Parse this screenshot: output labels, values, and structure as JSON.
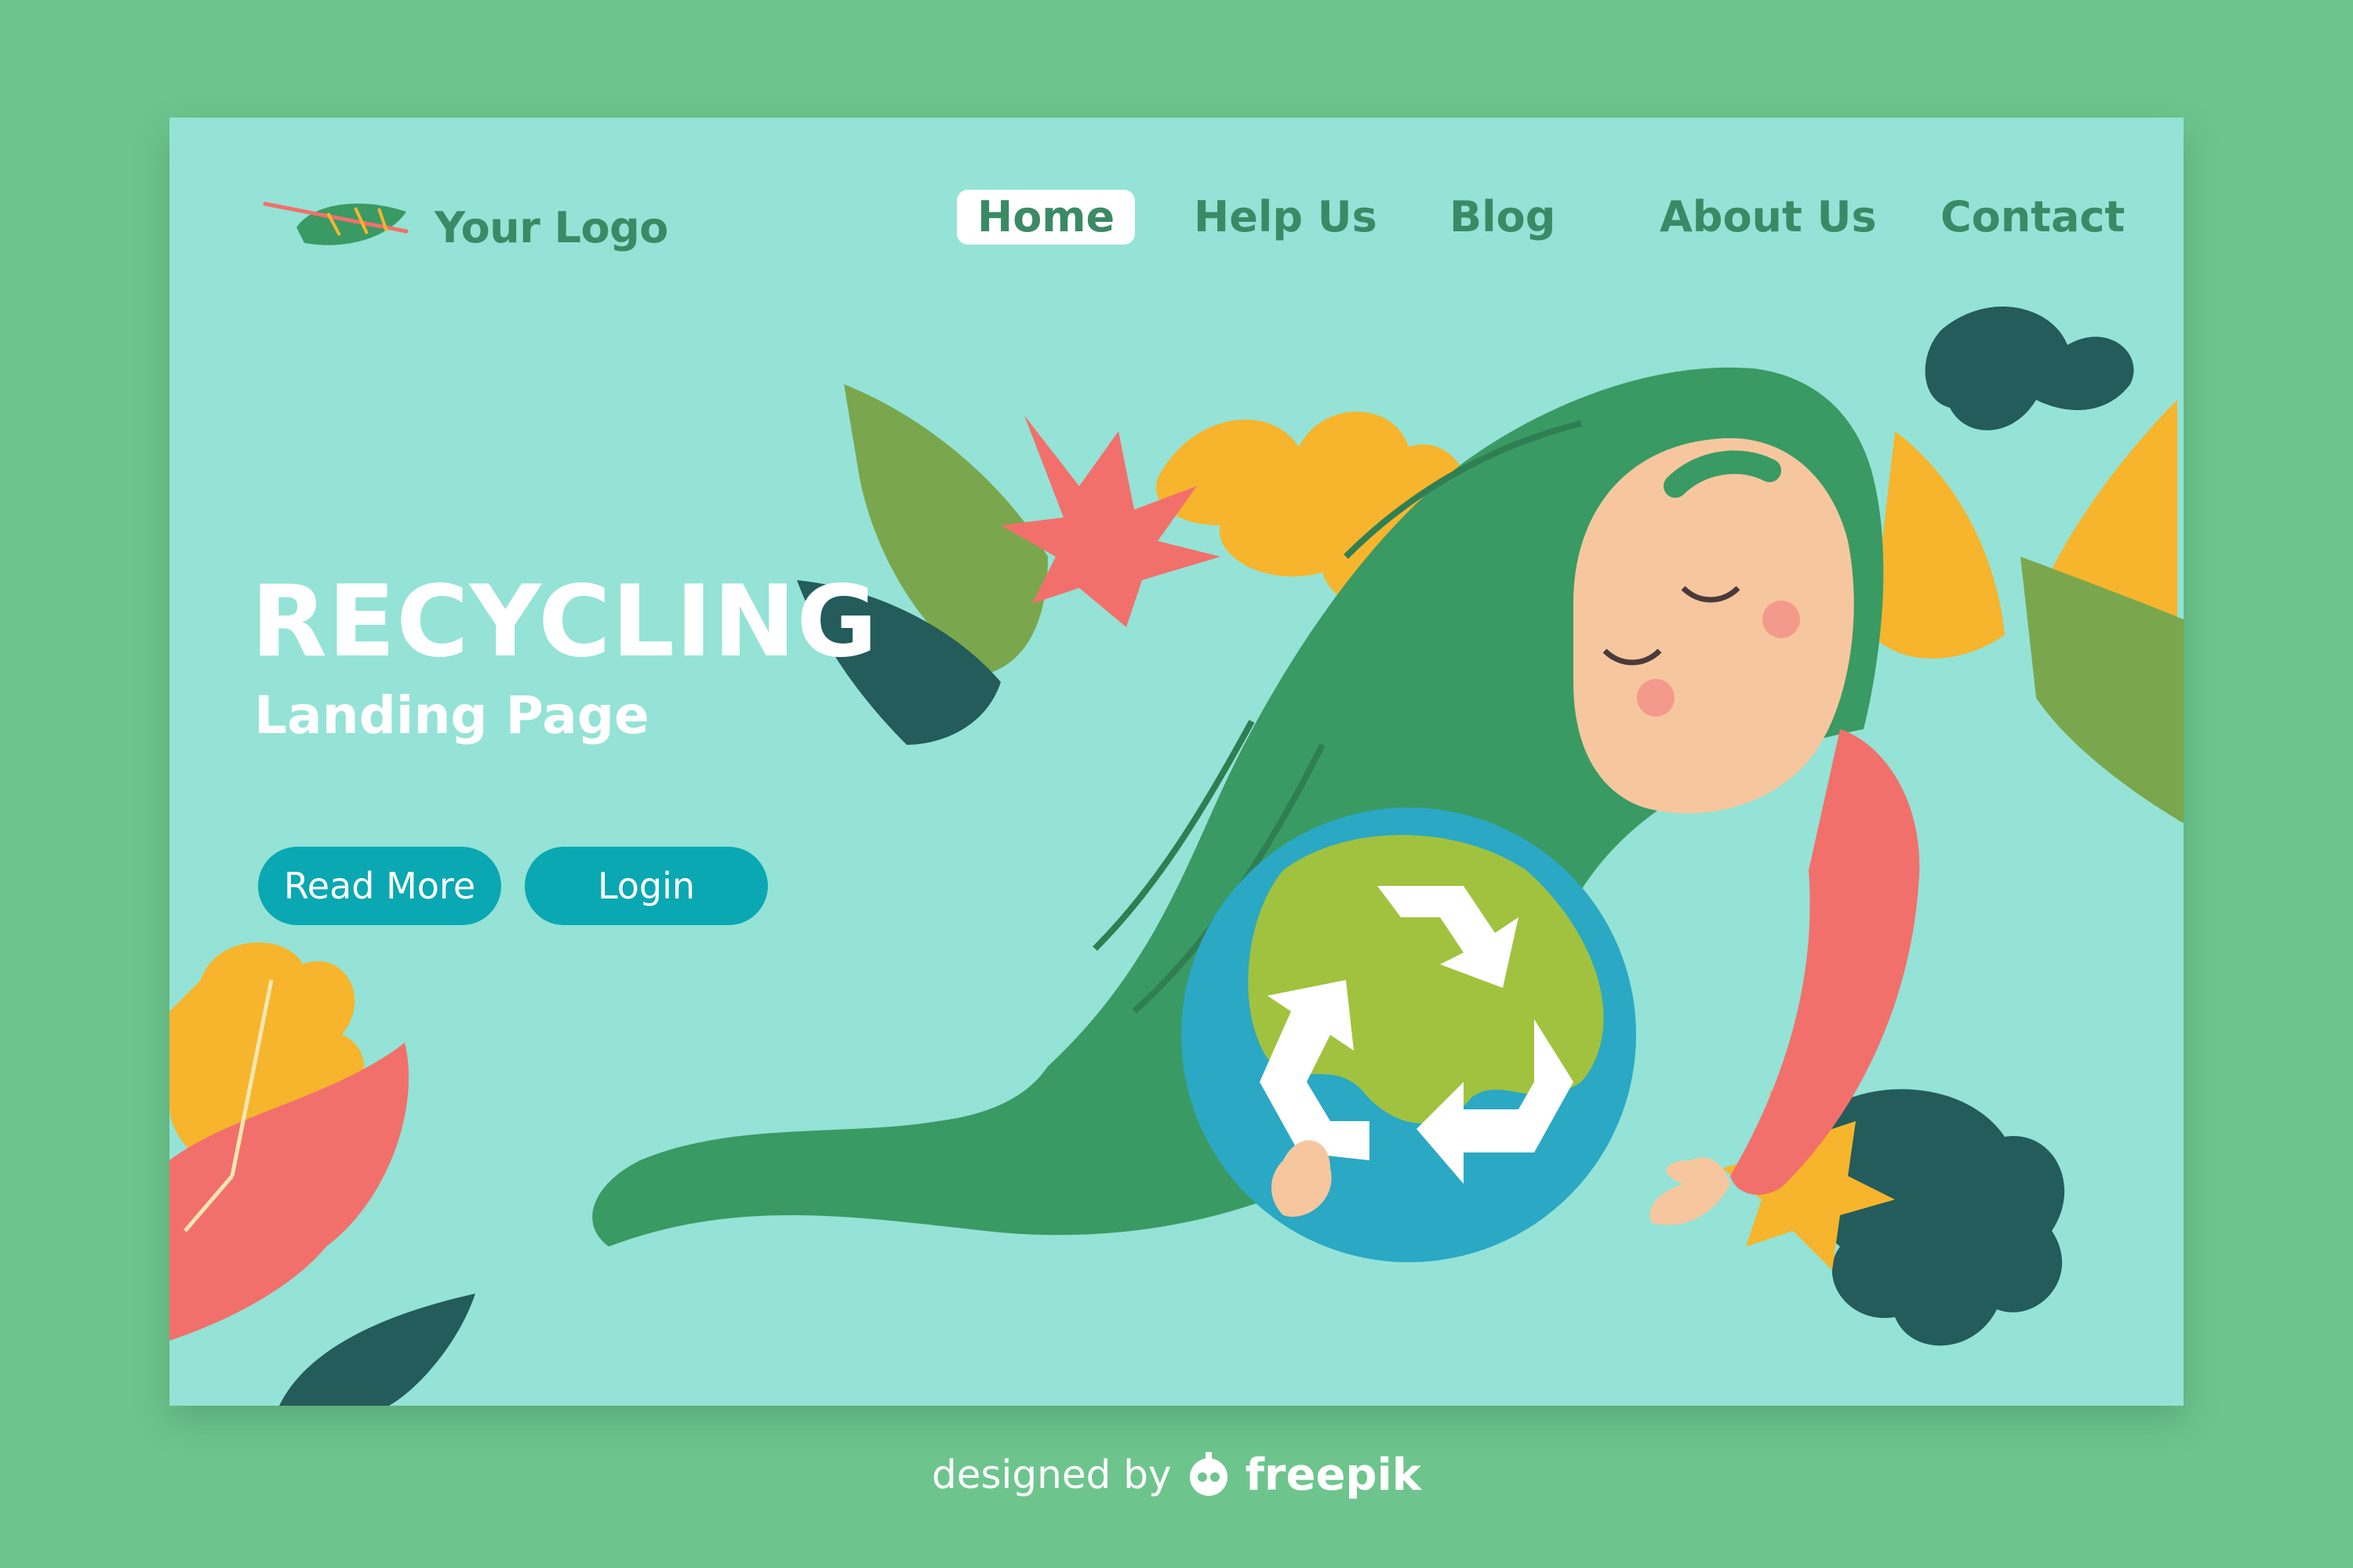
{
  "brand": {
    "logo_text": "Your Logo"
  },
  "nav": {
    "items": [
      {
        "label": "Home",
        "active": true
      },
      {
        "label": "Help Us",
        "active": false
      },
      {
        "label": "Blog",
        "active": false
      },
      {
        "label": "About Us",
        "active": false
      },
      {
        "label": "Contact",
        "active": false
      }
    ]
  },
  "hero": {
    "title": "RECYCLING",
    "subtitle": "Landing Page",
    "buttons": {
      "read_more": "Read More",
      "login": "Login"
    }
  },
  "footer": {
    "designed_by": "designed by",
    "brand": "freepik"
  },
  "colors": {
    "page_bg": "#6dc58d",
    "card_bg": "#94e3d6",
    "nav_text": "#3b8a66",
    "button_bg": "#0aa8b3",
    "hair": "#3a9a64",
    "earth_water": "#2ba8c4",
    "earth_land": "#a1c23f",
    "shirt": "#f2706b"
  }
}
